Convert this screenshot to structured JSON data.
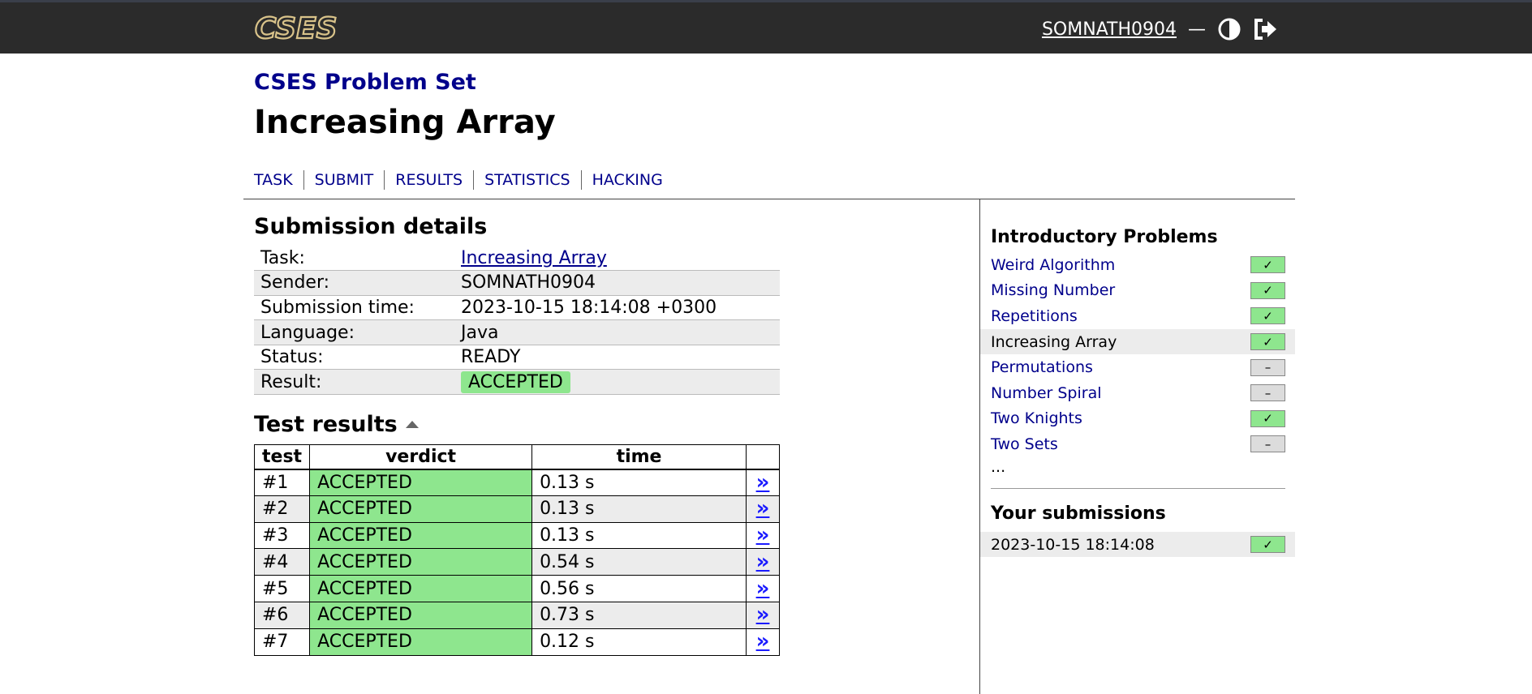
{
  "header": {
    "logo_text": "CSES",
    "username": "SOMNATH0904",
    "separator": "—",
    "icons": [
      "contrast-icon",
      "logout-icon"
    ]
  },
  "breadcrumb": "CSES Problem Set",
  "page_title": "Increasing Array",
  "tabs": [
    "TASK",
    "SUBMIT",
    "RESULTS",
    "STATISTICS",
    "HACKING"
  ],
  "submission": {
    "heading": "Submission details",
    "rows": [
      {
        "label": "Task:",
        "value": "Increasing Array"
      },
      {
        "label": "Sender:",
        "value": "SOMNATH0904"
      },
      {
        "label": "Submission time:",
        "value": "2023-10-15 18:14:08 +0300"
      },
      {
        "label": "Language:",
        "value": "Java"
      },
      {
        "label": "Status:",
        "value": "READY"
      },
      {
        "label": "Result:",
        "value": "ACCEPTED"
      }
    ]
  },
  "tests": {
    "heading": "Test results",
    "columns": [
      "test",
      "verdict",
      "time"
    ],
    "arrow": "»",
    "rows": [
      {
        "test": "#1",
        "verdict": "ACCEPTED",
        "time": "0.13 s"
      },
      {
        "test": "#2",
        "verdict": "ACCEPTED",
        "time": "0.13 s"
      },
      {
        "test": "#3",
        "verdict": "ACCEPTED",
        "time": "0.13 s"
      },
      {
        "test": "#4",
        "verdict": "ACCEPTED",
        "time": "0.54 s"
      },
      {
        "test": "#5",
        "verdict": "ACCEPTED",
        "time": "0.56 s"
      },
      {
        "test": "#6",
        "verdict": "ACCEPTED",
        "time": "0.73 s"
      },
      {
        "test": "#7",
        "verdict": "ACCEPTED",
        "time": "0.12 s"
      }
    ]
  },
  "sidebar": {
    "section_title": "Introductory Problems",
    "problems": [
      {
        "name": "Weird Algorithm",
        "status": "solved",
        "current": false
      },
      {
        "name": "Missing Number",
        "status": "solved",
        "current": false
      },
      {
        "name": "Repetitions",
        "status": "solved",
        "current": false
      },
      {
        "name": "Increasing Array",
        "status": "solved",
        "current": true
      },
      {
        "name": "Permutations",
        "status": "unsolved",
        "current": false
      },
      {
        "name": "Number Spiral",
        "status": "unsolved",
        "current": false
      },
      {
        "name": "Two Knights",
        "status": "solved",
        "current": false
      },
      {
        "name": "Two Sets",
        "status": "unsolved",
        "current": false
      }
    ],
    "more": "...",
    "submissions_title": "Your submissions",
    "submissions": [
      {
        "time": "2023-10-15 18:14:08",
        "status": "solved"
      }
    ],
    "mark_solved": "✓",
    "mark_unsolved": "–"
  },
  "colors": {
    "accepted": "#8ee68e",
    "link": "#00008b",
    "header_bg": "#2b2b2b"
  }
}
